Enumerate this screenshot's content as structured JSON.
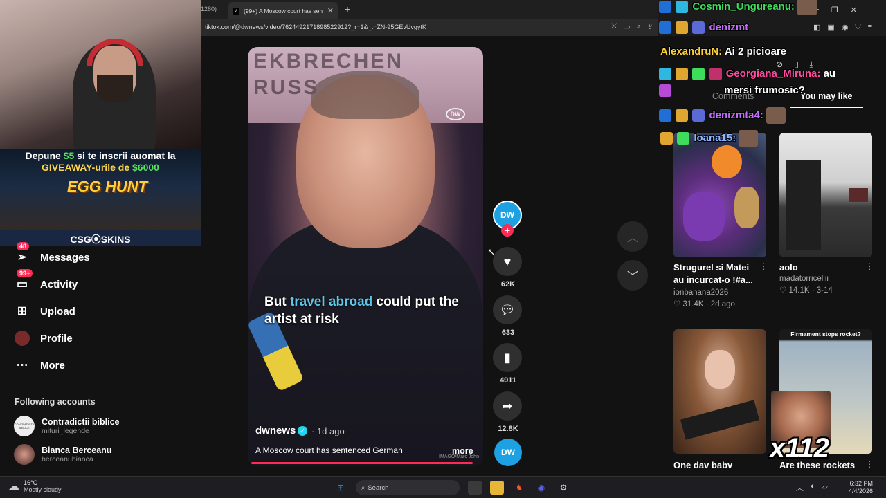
{
  "browser": {
    "prev_tab": "1280)",
    "active_tab_title": "(99+) A Moscow court has sentenced",
    "url": "tiktok.com/@dwnews/video/7624492171898522912?_r=1&_t=ZN-95GEvUvgytK"
  },
  "stream_overlay": {
    "promo_line1_a": "Depune ",
    "promo_line1_amount": "$5",
    "promo_line1_b": " si te inscrii auomat la",
    "promo_line2_a": "GIVEAWAY-urile de ",
    "promo_line2_amount": "$6000",
    "promo_game": "EGG HUNT",
    "promo_brand": "CSG⦿SKINS"
  },
  "sidebar": {
    "items": [
      {
        "label": "Messages",
        "badge": "48",
        "icon": "send-icon"
      },
      {
        "label": "Activity",
        "badge": "99+",
        "icon": "inbox-icon"
      },
      {
        "label": "Upload",
        "badge": "",
        "icon": "plus-square-icon"
      },
      {
        "label": "Profile",
        "badge": "",
        "icon": "profile-avatar"
      },
      {
        "label": "More",
        "badge": "",
        "icon": "more-dots-icon"
      }
    ],
    "following_heading": "Following accounts",
    "accounts": [
      {
        "name": "Contradictii biblice",
        "handle": "mituri_legende",
        "avatar_text": "CONTRADICTII BIBLICE"
      },
      {
        "name": "Bianca Berceanu",
        "handle": "berceanubianca",
        "avatar_text": ""
      }
    ]
  },
  "video": {
    "banner_text": "EKBRECHEN\nRUSS",
    "watermark": "DW",
    "caption_a": "But ",
    "caption_highlight": "travel abroad",
    "caption_b": " could put the artist at risk",
    "author": "dwnews",
    "time_ago": "· 1d ago",
    "description": "A Moscow court has sentenced German",
    "more": "more",
    "credit": "IMAGO/Marc John",
    "progress": 0.97
  },
  "actions": {
    "avatar_text": "DW",
    "likes": "62K",
    "comments": "633",
    "saves": "4911",
    "shares": "12.8K"
  },
  "right_panel": {
    "tab_comments": "Comments",
    "tab_you_may_like": "You may like",
    "cards": [
      {
        "title": "Strugurel si Matei au incurcat-o !#a...",
        "author": "ionbanana2026",
        "meta": "♡ 31.4K · 2d ago"
      },
      {
        "title": "",
        "author": "aolo",
        "sub": "madatorricellii",
        "meta": "♡ 14.1K · 3-14"
      },
      {
        "title": "One dav babv",
        "author": "",
        "meta": ""
      },
      {
        "title": "Are these rockets",
        "author": "",
        "meta": "",
        "thumb_caption": "Firmament stops rocket?"
      }
    ]
  },
  "chat": [
    {
      "user": "Cosmin_Ungureanu:",
      "color": "#3ddc5a",
      "text": ""
    },
    {
      "user": "denizmt",
      "color": "#c46cff",
      "text": ""
    },
    {
      "user": "AlexandruN:",
      "color": "#ffd23a",
      "text": "Ai 2 picioare"
    },
    {
      "user": "Georgiana_Miruna:",
      "color": "#ff4aa0",
      "text": "au"
    },
    {
      "user": "",
      "color": "#ffffff",
      "text": "mersi frumosic?"
    },
    {
      "user": "denizmta4:",
      "color": "#c46cff",
      "text": ""
    },
    {
      "user": "Ioana15:",
      "color": "#8fb7ff",
      "text": ""
    }
  ],
  "chat_combo": "x112",
  "taskbar": {
    "temp": "16°C",
    "weather": "Mostly cloudy",
    "search": "Search",
    "time": "6:32 PM",
    "date": "4/4/2026"
  }
}
